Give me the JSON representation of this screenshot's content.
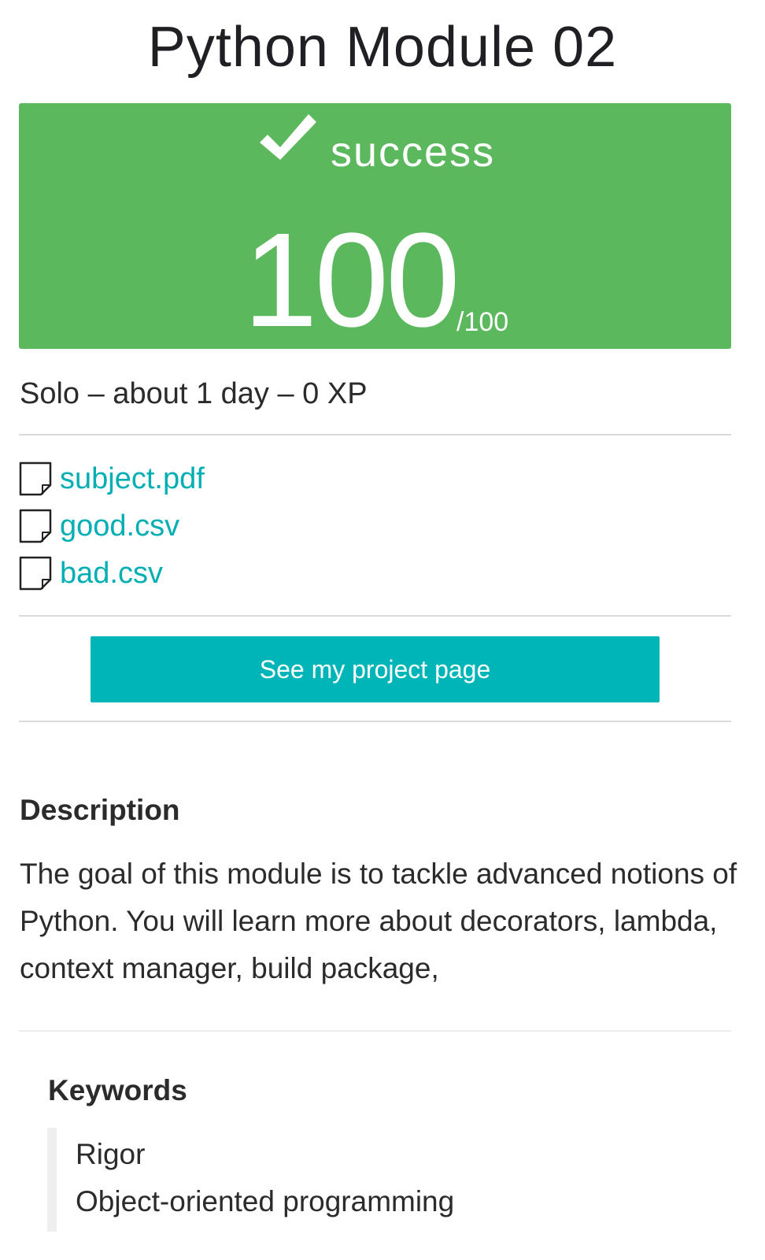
{
  "project": {
    "title": "Python Module 02"
  },
  "result": {
    "status": "success",
    "score": "100",
    "score_max": "/100",
    "accent_color": "#5cb85c"
  },
  "meta": {
    "text": "Solo – about 1 day – 0 XP"
  },
  "attachments": [
    {
      "name": "subject.pdf",
      "icon": "file-icon"
    },
    {
      "name": "good.csv",
      "icon": "file-icon"
    },
    {
      "name": "bad.csv",
      "icon": "file-icon"
    }
  ],
  "actions": {
    "project_page_label": "See my project page",
    "button_color": "#00b5b8"
  },
  "description": {
    "heading": "Description",
    "body": "The goal of this module is to tackle advanced notions of Python. You will learn more about decorators, lambda, context manager, build package,"
  },
  "keywords": {
    "heading": "Keywords",
    "items": [
      "Rigor",
      "Object-oriented programming"
    ]
  }
}
